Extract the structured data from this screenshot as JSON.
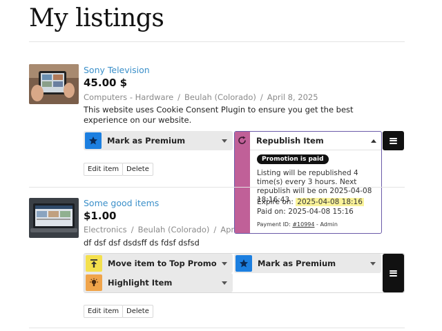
{
  "page": {
    "title": "My listings"
  },
  "listings": [
    {
      "title": "Sony Television",
      "price": "45.00 $",
      "category": "Computers - Hardware",
      "location": "Beulah (Colorado)",
      "date": "April 8, 2025",
      "description": "This website uses Cookie Consent Plugin to ensure you get the best experience on our website.",
      "actions": {
        "premium": "Mark as Premium",
        "republish": "Republish Item"
      },
      "buttons": {
        "edit": "Edit item",
        "delete": "Delete"
      }
    },
    {
      "title": "Some good items",
      "price": "$1.00",
      "category": "Electronics",
      "location": "Beulah (Colorado)",
      "date": "April 8, 2",
      "description": "df dsf dsf dsdsff ds fdsf dsfsd",
      "actions": {
        "top": "Move item to Top Promo",
        "premium": "Mark as Premium",
        "highlight": "Highlight Item"
      },
      "buttons": {
        "edit": "Edit item",
        "delete": "Delete"
      }
    }
  ],
  "popup": {
    "badge": "Promotion is paid",
    "message": "Listing will be republished 4 time(s) every 3 hours. Next republish will be on 2025-04-08 18:16:43",
    "expire_label": "Expire on:",
    "expire_value": "2025-04-08 18:16",
    "paid_label": "Paid on:",
    "paid_value": "2025-04-08 15:16",
    "payment_label": "Payment ID:",
    "payment_id": "#10994",
    "payment_suffix": "- Admin"
  },
  "colors": {
    "link": "#3a8fc9",
    "premium_icon": "#1c7fe0",
    "top_icon": "#f4e04d",
    "highlight_icon": "#f0a44a",
    "republish_stripe": "#c06098",
    "popup_border": "#6a5aa8"
  },
  "icons": [
    "star-icon",
    "upload-icon",
    "lightbulb-icon",
    "redo-icon",
    "menu-icon",
    "chevron-down-icon",
    "chevron-up-icon"
  ]
}
